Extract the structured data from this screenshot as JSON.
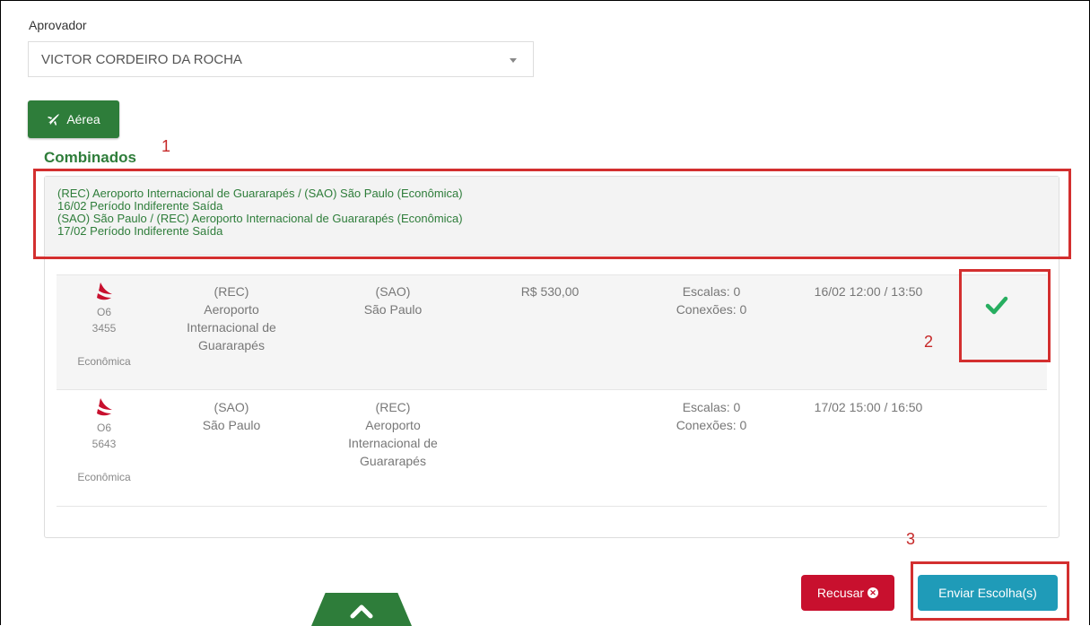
{
  "approver": {
    "label": "Aprovador",
    "selected": "VICTOR CORDEIRO DA ROCHA"
  },
  "air_button": {
    "label": "Aérea",
    "icon": "plane-icon"
  },
  "section_title": "Combinados",
  "annotations": [
    "1",
    "2",
    "3"
  ],
  "summary": [
    "(REC) Aeroporto Internacional de Guararapés / (SAO) São Paulo (Econômica)",
    "16/02 Período Indiferente Saída",
    "(SAO) São Paulo / (REC) Aeroporto Internacional de Guararapés (Econômica)",
    "17/02 Período Indiferente Saída"
  ],
  "flights": [
    {
      "airline_code": "O6",
      "flight_number": "3455",
      "class": "Econômica",
      "origin_code": "(REC)",
      "origin_name": "Aeroporto Internacional de Guararapés",
      "dest_code": "(SAO)",
      "dest_name": "São Paulo",
      "price": "R$ 530,00",
      "stops": "Escalas: 0",
      "connections": "Conexões: 0",
      "times": "16/02 12:00 / 13:50",
      "selected": true
    },
    {
      "airline_code": "O6",
      "flight_number": "5643",
      "class": "Econômica",
      "origin_code": "(SAO)",
      "origin_name": "São Paulo",
      "dest_code": "(REC)",
      "dest_name": "Aeroporto Internacional de Guararapés",
      "price": "",
      "stops": "Escalas: 0",
      "connections": "Conexões: 0",
      "times": "17/02 15:00 / 16:50",
      "selected": false
    }
  ],
  "buttons": {
    "refuse": "Recusar",
    "send": "Enviar Escolha(s)"
  },
  "colors": {
    "brand_green": "#2e7d3a",
    "refuse_red": "#c8102e",
    "send_blue": "#1f9bb8",
    "check_green": "#27ae60",
    "annotation_red": "#d32f2f",
    "airline_red": "#c8102e"
  }
}
